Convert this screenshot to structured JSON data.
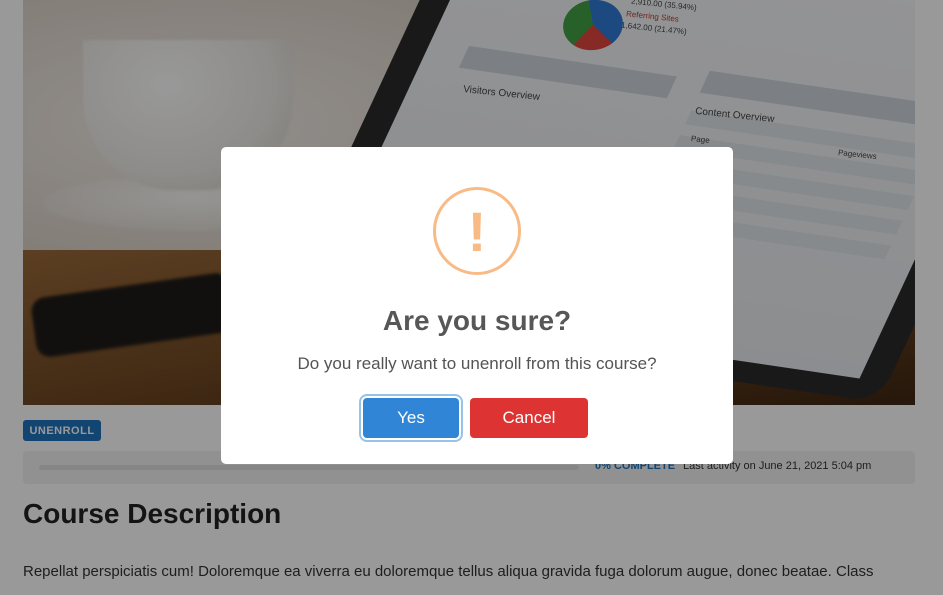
{
  "course": {
    "unenroll_label": "UNENROLL",
    "progress_percent": 0,
    "progress_label": "0% COMPLETE",
    "last_activity": "Last activity on June 21, 2021 5:04 pm",
    "section_title": "Course Description",
    "description": "Repellat perspiciatis cum! Doloremque ea viverra eu doloremque tellus aliqua gravida fuga dolorum augue, donec beatae. Class"
  },
  "hero_image": {
    "screen_texts": [
      "2,910.00 (35.94%)",
      "Referring Sites",
      "1,642.00 (21.47%)",
      "Visitors Overview",
      "Content Overview",
      "Page",
      "Pageviews"
    ]
  },
  "dialog": {
    "icon": "!",
    "title": "Are you sure?",
    "message": "Do you really want to unenroll from this course?",
    "confirm_label": "Yes",
    "cancel_label": "Cancel"
  },
  "colors": {
    "primary": "#1e73be",
    "confirm": "#3085d6",
    "cancel": "#dd3333",
    "warning": "#f8bb86"
  }
}
